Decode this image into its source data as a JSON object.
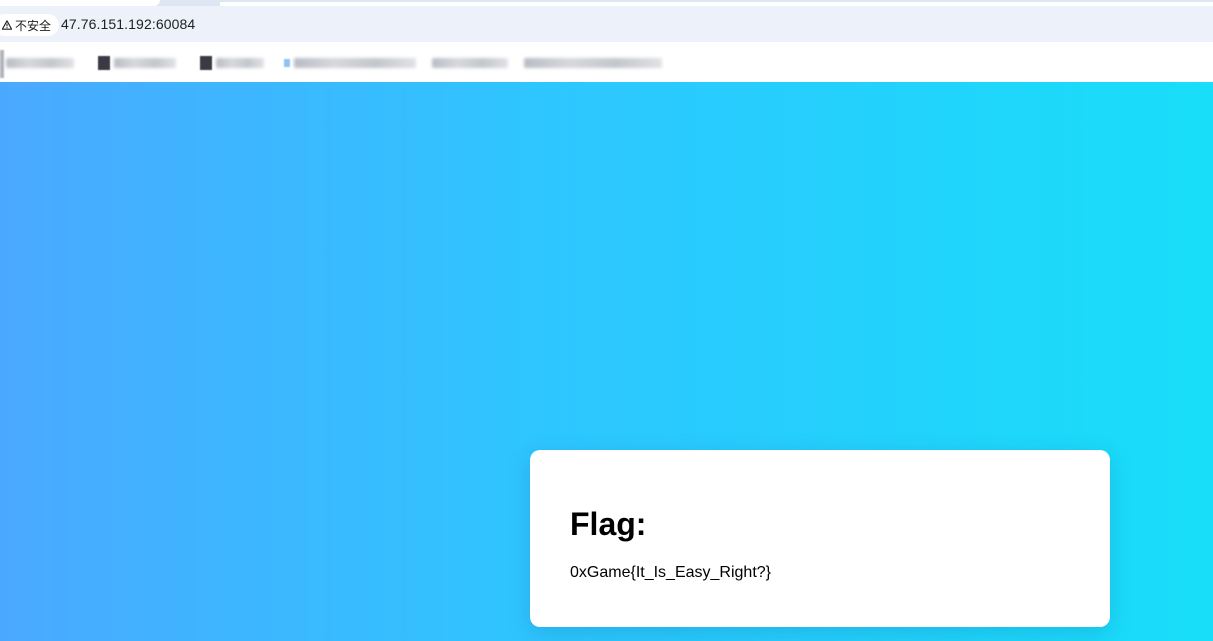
{
  "browser": {
    "security_label": "不安全",
    "url": "47.76.151.192:60084",
    "icons": {
      "security": "warning-triangle-icon"
    }
  },
  "page": {
    "card": {
      "title": "Flag:",
      "flag": "0xGame{It_Is_Easy_Right?}"
    },
    "colors": {
      "gradient_start": "#4aa9ff",
      "gradient_end": "#18def9",
      "card_background": "#ffffff"
    }
  }
}
